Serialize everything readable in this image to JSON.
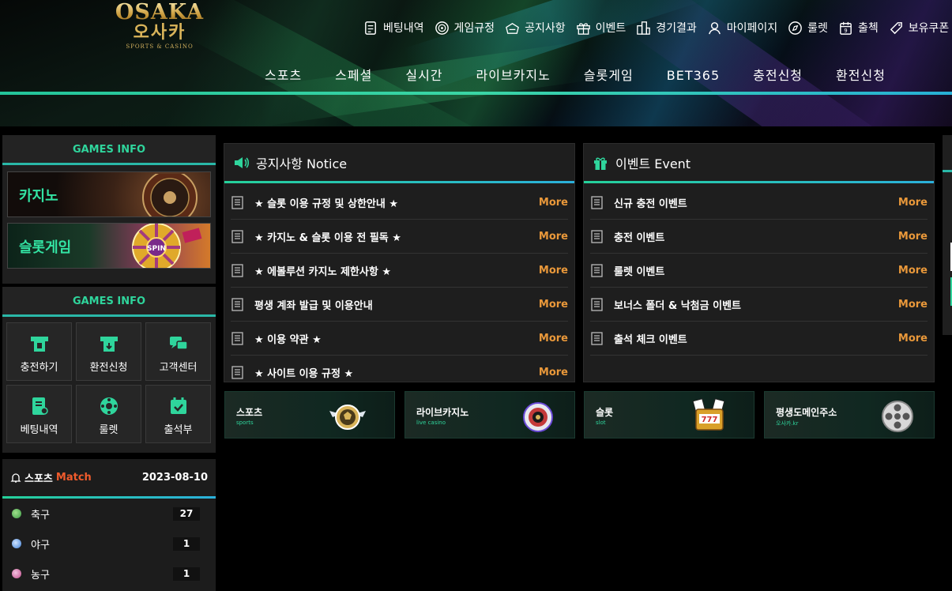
{
  "logo": {
    "en": "OSAKA",
    "ko": "오사카",
    "sub": "SPORTS & CASINO"
  },
  "topnav": [
    {
      "label": "베팅내역",
      "icon": "betting-history-icon"
    },
    {
      "label": "게임규정",
      "icon": "target-icon"
    },
    {
      "label": "공지사항",
      "icon": "megaphone-icon"
    },
    {
      "label": "이벤트",
      "icon": "gift-icon"
    },
    {
      "label": "경기결과",
      "icon": "buildings-icon"
    },
    {
      "label": "마이페이지",
      "icon": "user-icon"
    },
    {
      "label": "룰렛",
      "icon": "compass-icon"
    },
    {
      "label": "출첵",
      "icon": "calendar-icon"
    },
    {
      "label": "보유쿠폰",
      "icon": "coupon-icon"
    }
  ],
  "mainnav": [
    "스포츠",
    "스페셜",
    "실시간",
    "라이브카지노",
    "슬롯게임",
    "BET365",
    "충전신청",
    "환전신청"
  ],
  "games_info_1": {
    "title": "GAMES INFO",
    "banners": [
      {
        "label": "카지노"
      },
      {
        "label": "슬롯게임"
      }
    ]
  },
  "games_info_2": {
    "title": "GAMES INFO",
    "buttons": [
      {
        "label": "충전하기",
        "icon": "deposit-icon"
      },
      {
        "label": "환전신청",
        "icon": "withdraw-icon"
      },
      {
        "label": "고객센터",
        "icon": "chat-icon"
      },
      {
        "label": "베팅내역",
        "icon": "bet-slip-icon"
      },
      {
        "label": "룰렛",
        "icon": "roulette-icon"
      },
      {
        "label": "출석부",
        "icon": "attendance-icon"
      }
    ]
  },
  "match": {
    "title": "스포츠",
    "title_accent": "Match",
    "date": "2023-08-10",
    "rows": [
      {
        "sport": "축구",
        "count": "27",
        "color": "#3b9b46"
      },
      {
        "sport": "야구",
        "count": "1",
        "color": "#3d7fd6"
      },
      {
        "sport": "농구",
        "count": "1",
        "color": "#c04a8a"
      }
    ]
  },
  "notice": {
    "title": "공지사항 Notice",
    "more_label": "More",
    "items": [
      "★ 슬롯 이용 규정 및 상한안내 ★",
      "★ 카지노 & 슬롯 이용 전 필독 ★",
      "★ 에볼루션 카지노 제한사항 ★",
      "평생 계좌 발급 및 이용안내",
      "★ 이용 약관 ★",
      "★ 사이트 이용 규정 ★"
    ]
  },
  "event": {
    "title": "이벤트 Event",
    "more_label": "More",
    "items": [
      "신규 충전 이벤트",
      "충전 이벤트",
      "룰렛 이벤트",
      "보너스 폴더 & 낙첨금 이벤트",
      "출석 체크 이벤트"
    ]
  },
  "quick_banners": [
    {
      "title": "스포츠",
      "sub": "sports",
      "icon": "soccer-ball-icon"
    },
    {
      "title": "라이브카지노",
      "sub": "live casino",
      "icon": "roulette-wheel-icon"
    },
    {
      "title": "슬롯",
      "sub": "slot",
      "icon": "slot-machine-icon"
    },
    {
      "title": "평생도메인주소",
      "sub": "오사카.kr",
      "icon": "film-reel-icon"
    }
  ],
  "colors": {
    "accent_green": "#2fd59c",
    "more_orange": "#e9983a",
    "match_orange": "#f05b2c"
  }
}
